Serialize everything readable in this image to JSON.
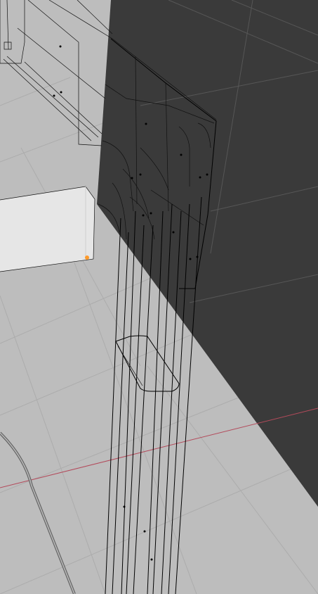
{
  "viewport": {
    "background_color": "#bdbdbd",
    "grid_color": "#acacac",
    "dark_plane_color": "#3a3a3a",
    "white_plane_color": "#e6e6e6",
    "x_axis_color": "#b34a5b",
    "wire_color": "#000000",
    "selected_vertex_color": "#ff9a2a"
  }
}
